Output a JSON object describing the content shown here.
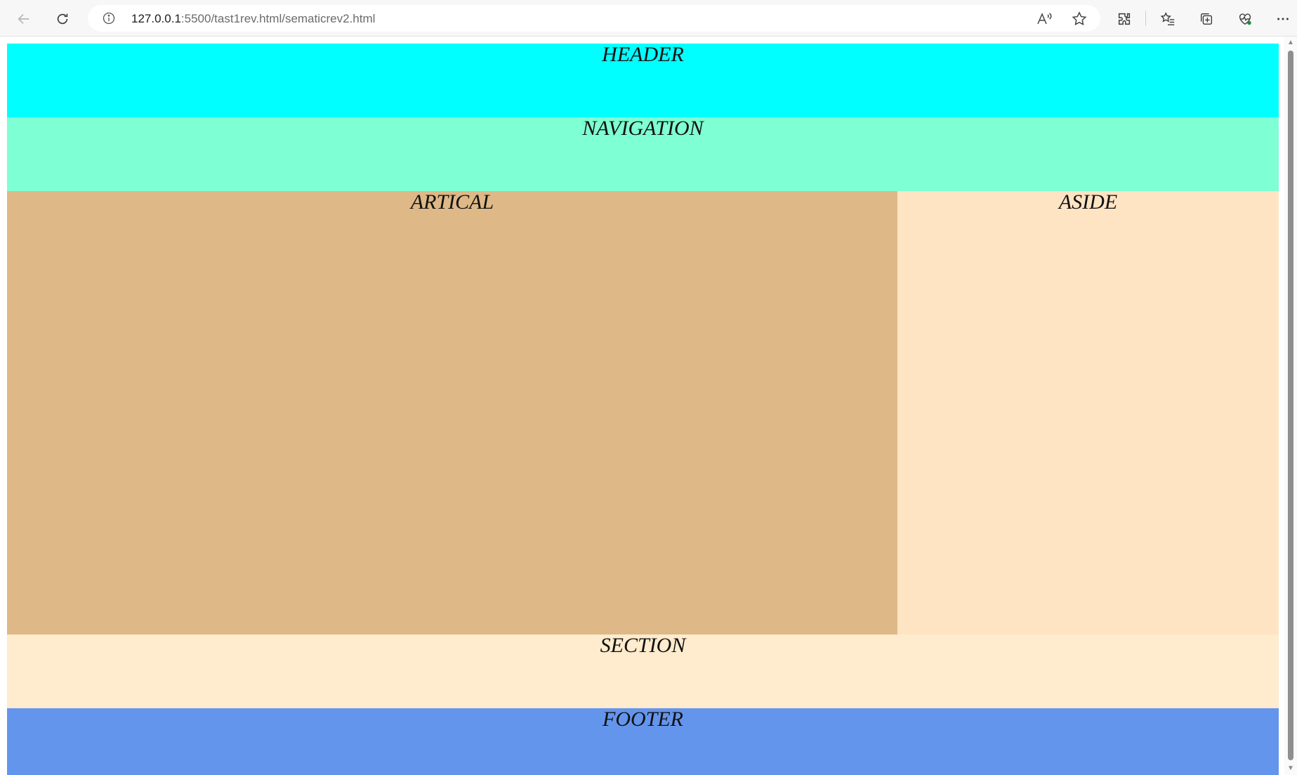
{
  "browser": {
    "url_host": "127.0.0.1",
    "url_rest": ":5500/tast1rev.html/sematicrev2.html",
    "icons": {
      "back": "back-arrow-icon",
      "refresh": "refresh-icon",
      "info": "info-icon",
      "read_aloud": "read-aloud-icon",
      "favorite": "favorite-star-icon",
      "extensions": "extensions-icon",
      "favorites": "favorites-list-icon",
      "collections": "collections-icon",
      "performance": "browser-essentials-icon",
      "more": "more-options-icon"
    }
  },
  "layout_sections": {
    "header": "HEADER",
    "navigation": "NAVIGATION",
    "article": "ARTICAL",
    "aside": "ASIDE",
    "section": "SECTION",
    "footer": "FOOTER"
  },
  "colors": {
    "header": "#00ffff",
    "navigation": "#7fffd4",
    "article": "#deb887",
    "aside": "#ffe4c4",
    "section": "#ffebcd",
    "footer": "#6495ed"
  }
}
